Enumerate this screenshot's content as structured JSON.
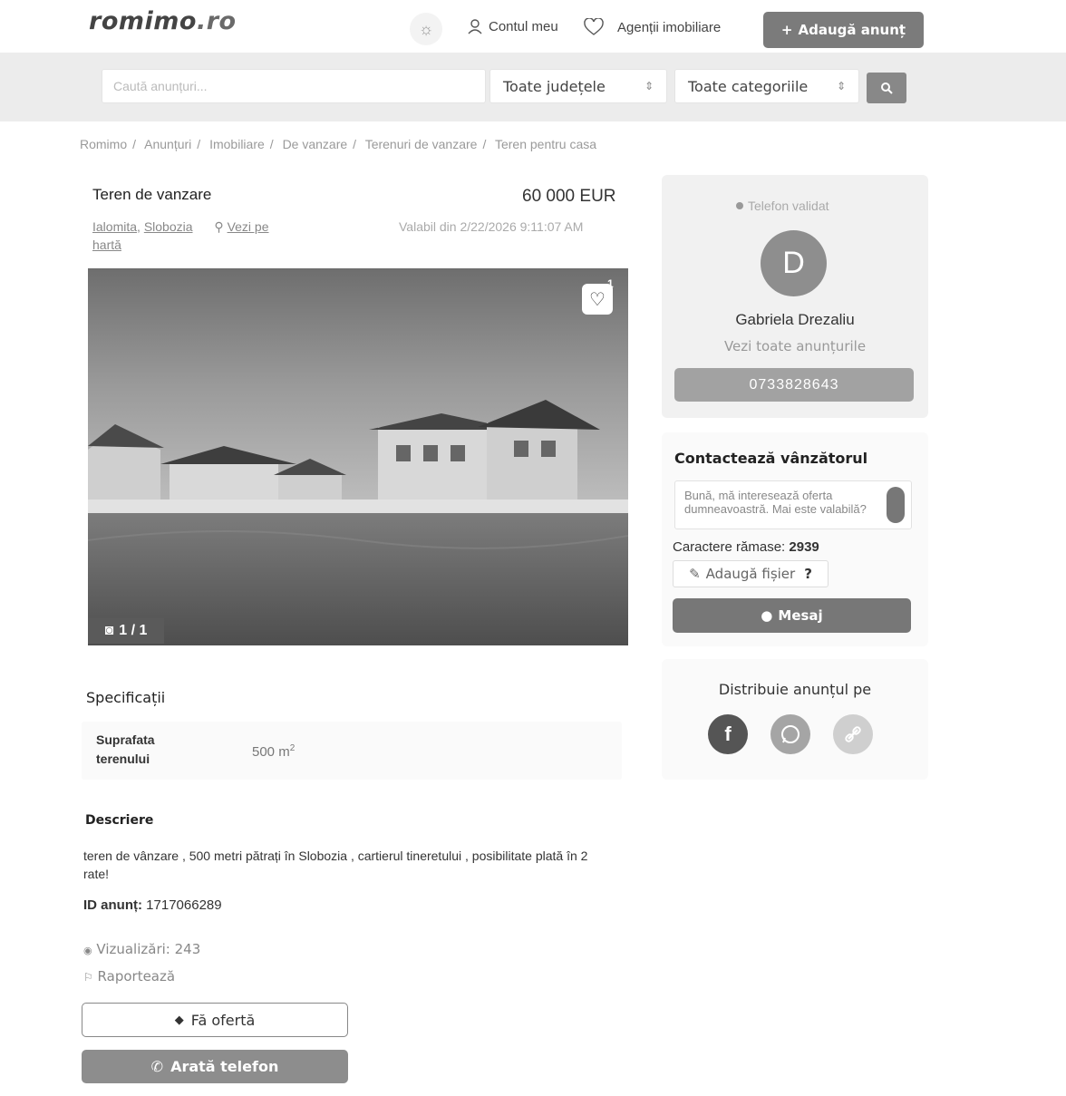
{
  "header": {
    "logo_main": "romimo",
    "logo_tld": ".ro",
    "account_label": "Contul meu",
    "agents_label": "Agenții imobiliare",
    "add_listing_label": "Adaugă anunț"
  },
  "search": {
    "placeholder": "Caută anunțuri...",
    "county_selected": "Toate județele",
    "category_selected": "Toate categoriile"
  },
  "breadcrumb": [
    "Romimo",
    "Anunțuri",
    "Imobiliare",
    "De vanzare",
    "Terenuri de vanzare",
    "Teren pentru casa"
  ],
  "listing": {
    "title": "Teren de vanzare",
    "price": "60 000 EUR",
    "location_county": "Ialomita",
    "location_city": "Slobozia",
    "map_link": "Vezi pe hartă",
    "valid_since": "Valabil din 2/22/2026 9:11:07 AM",
    "favorites_count": "1",
    "photo_counter": "1 / 1"
  },
  "specs": {
    "title": "Specificații",
    "items": [
      {
        "label_line1": "Suprafata",
        "label_line2": "terenului",
        "value": "500 m",
        "unit_sup": "2"
      }
    ]
  },
  "description": {
    "title": "Descriere",
    "text": "teren de vânzare , 500 metri pătrați în Slobozia , cartierul tineretului , posibilitate plată în 2 rate!",
    "id_label": "ID anunț:",
    "id_value": "1717066289"
  },
  "stats": {
    "views": "Vizualizări: 243",
    "report": "Raportează"
  },
  "actions": {
    "offer": "Fă ofertă",
    "show_phone": "Arată telefon"
  },
  "seller": {
    "phone_validated": "Telefon validat",
    "avatar_letter": "D",
    "name": "Gabriela Drezaliu",
    "see_all": "Vezi toate anunțurile",
    "phone": "0733828643"
  },
  "contact": {
    "title": "Contactează vânzătorul",
    "message": "Bună, mă interesează oferta dumneavoastră. Mai este valabilă?",
    "chars_label": "Caractere rămase:",
    "chars_value": "2939",
    "attach": "Adaugă fișier",
    "attach_help": "?",
    "send": "Mesaj"
  },
  "share": {
    "title": "Distribuie anunțul pe",
    "facebook_icon": "f",
    "colors": {
      "facebook": "#555555",
      "whatsapp": "#a5a5a5",
      "link": "#cfcfcf"
    }
  }
}
